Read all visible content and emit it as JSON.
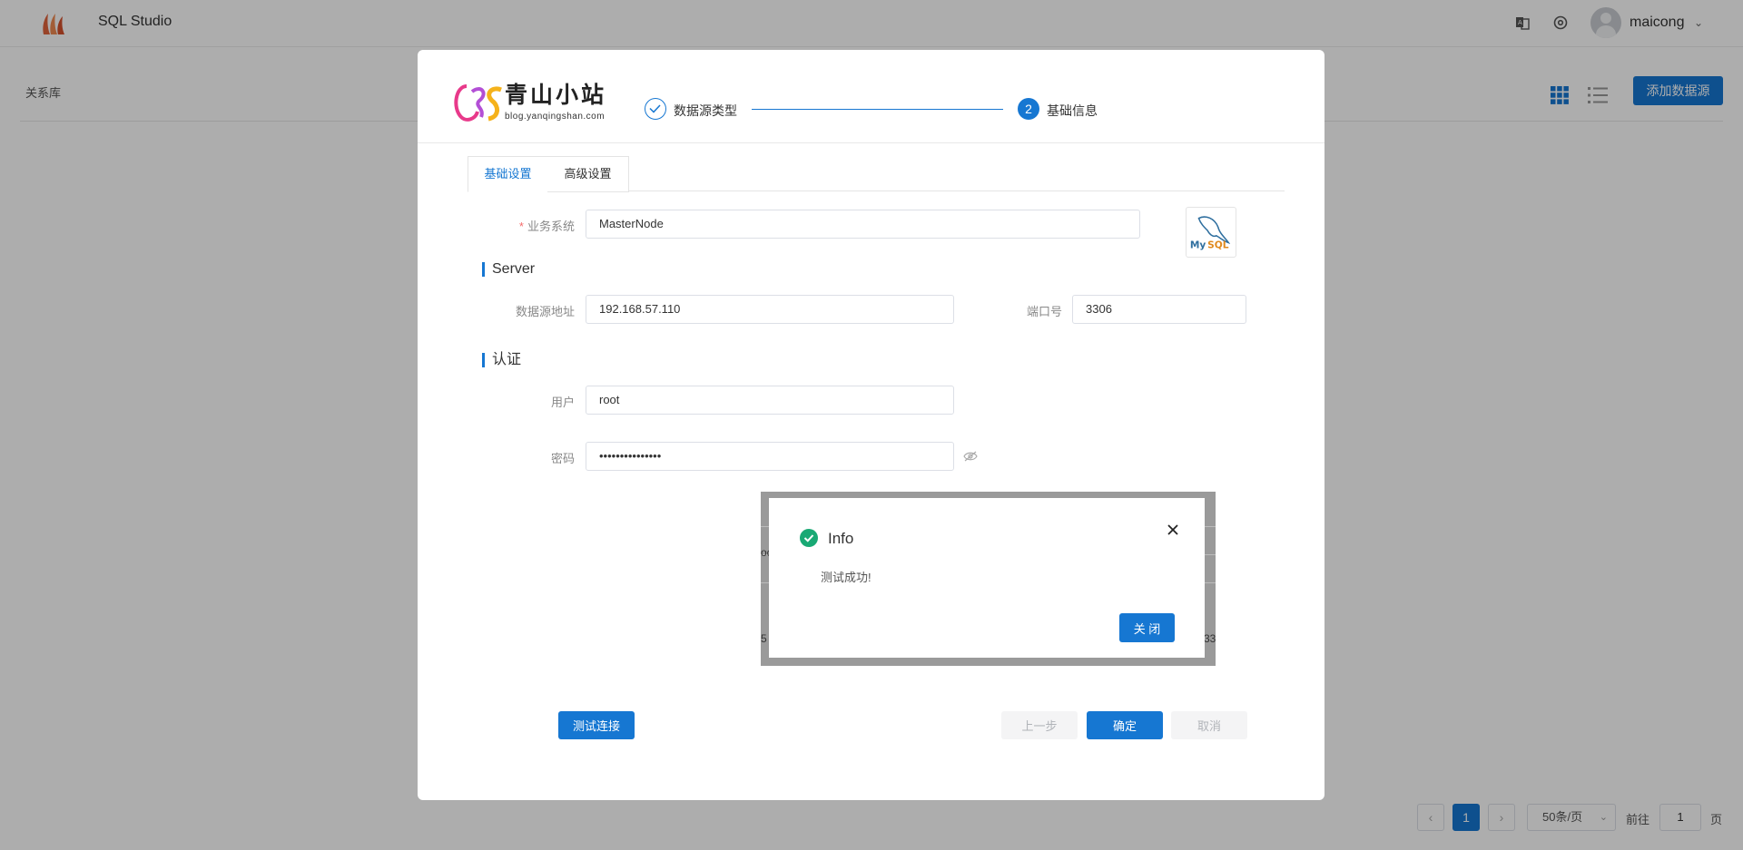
{
  "app": {
    "title": "SQL Studio",
    "username": "maicong",
    "icons": [
      "app-logo-icon",
      "translate-icon",
      "settings-icon",
      "avatar",
      "chevron-down-icon"
    ]
  },
  "page": {
    "breadcrumb": "关系库",
    "add_button": "添加数据源",
    "view_icons": [
      "grid-view-icon",
      "list-view-icon"
    ]
  },
  "pagination": {
    "prev": "‹",
    "current": "1",
    "next": "›",
    "page_size": "50条/页",
    "goto_label": "前往",
    "goto_value": "1",
    "page_suffix": "页"
  },
  "modal": {
    "brand": {
      "name": "青山小站",
      "url": "blog.yanqingshan.com"
    },
    "steps": [
      {
        "label": "数据源类型",
        "state": "done"
      },
      {
        "label": "基础信息",
        "number": "2",
        "state": "active"
      }
    ],
    "tabs": [
      {
        "label": "基础设置",
        "active": true
      },
      {
        "label": "高级设置",
        "active": false
      }
    ],
    "fields": {
      "business_system": {
        "label": "业务系统",
        "value": "MasterNode",
        "required": true
      },
      "server_section": "Server",
      "host": {
        "label": "数据源地址",
        "value": "192.168.57.110"
      },
      "port": {
        "label": "端口号",
        "value": "3306"
      },
      "auth_section": "认证",
      "user": {
        "label": "用户",
        "value": "root"
      },
      "password": {
        "label": "密码",
        "value": "•••••••••••••••"
      }
    },
    "db_logo": "MySQL",
    "buttons": {
      "test": "测试连接",
      "prev": "上一步",
      "ok": "确定",
      "cancel": "取消"
    }
  },
  "info_dialog": {
    "title": "Info",
    "message": "测试成功!",
    "close_button": "关 闭",
    "ghost_text": [
      "oc",
      "5",
      "33"
    ]
  },
  "colors": {
    "primary": "#1677d2",
    "success": "#19a974",
    "required": "#f56c6c"
  }
}
